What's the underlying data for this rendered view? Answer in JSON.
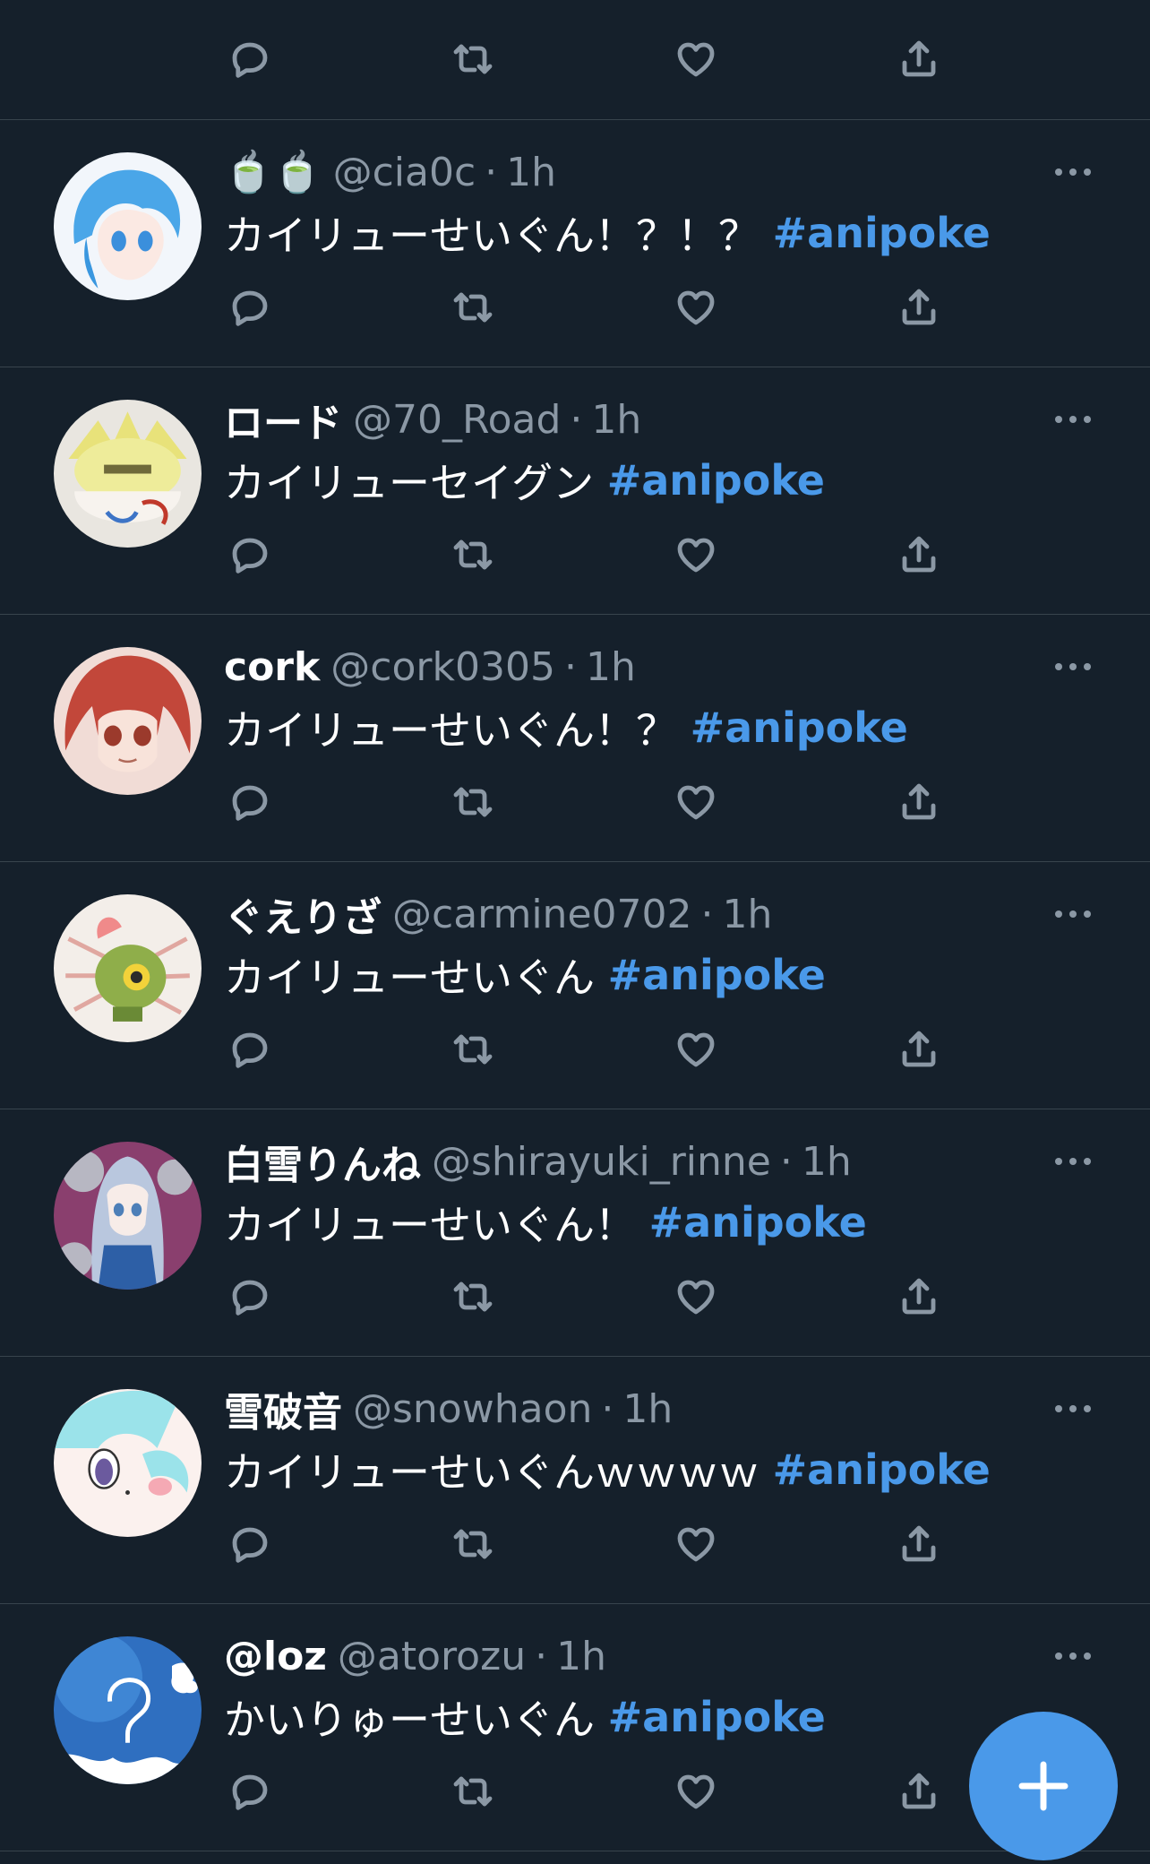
{
  "icons": {
    "reply": "reply-icon",
    "retweet": "retweet-icon",
    "like": "heart-icon",
    "share": "share-icon",
    "more": "more-icon",
    "compose": "plus-icon"
  },
  "colors": {
    "background": "#15202b",
    "divider": "#38444d",
    "muted": "#8b98a5",
    "accent": "#4a99e9"
  },
  "tweets": [
    {
      "display_name": "🍵🍵",
      "handle": "@cia0c",
      "dot": "·",
      "time": "1h",
      "text": "カイリューせいぐん！？！？ ",
      "hashtag": "#anipoke"
    },
    {
      "display_name": "ロード",
      "handle": "@70_Road",
      "dot": "·",
      "time": "1h",
      "text": "カイリューセイグン ",
      "hashtag": "#anipoke"
    },
    {
      "display_name": "cork",
      "handle": "@cork0305",
      "dot": "·",
      "time": "1h",
      "text": "カイリューせいぐん！？ ",
      "hashtag": "#anipoke"
    },
    {
      "display_name": "ぐえりざ",
      "handle": "@carmine0702",
      "dot": "·",
      "time": "1h",
      "text": "カイリューせいぐん ",
      "hashtag": "#anipoke"
    },
    {
      "display_name": "白雪りんね",
      "handle": "@shirayuki_rinne",
      "dot": "·",
      "time": "1h",
      "text": "カイリューせいぐん！ ",
      "hashtag": "#anipoke"
    },
    {
      "display_name": "雪破音",
      "handle": "@snowhaon",
      "dot": "·",
      "time": "1h",
      "text": "カイリューせいぐんｗｗｗｗ ",
      "hashtag": "#anipoke"
    },
    {
      "display_name": "@loz",
      "handle": "@atorozu",
      "dot": "·",
      "time": "1h",
      "text": "かいりゅーせいぐん ",
      "hashtag": "#anipoke"
    }
  ]
}
